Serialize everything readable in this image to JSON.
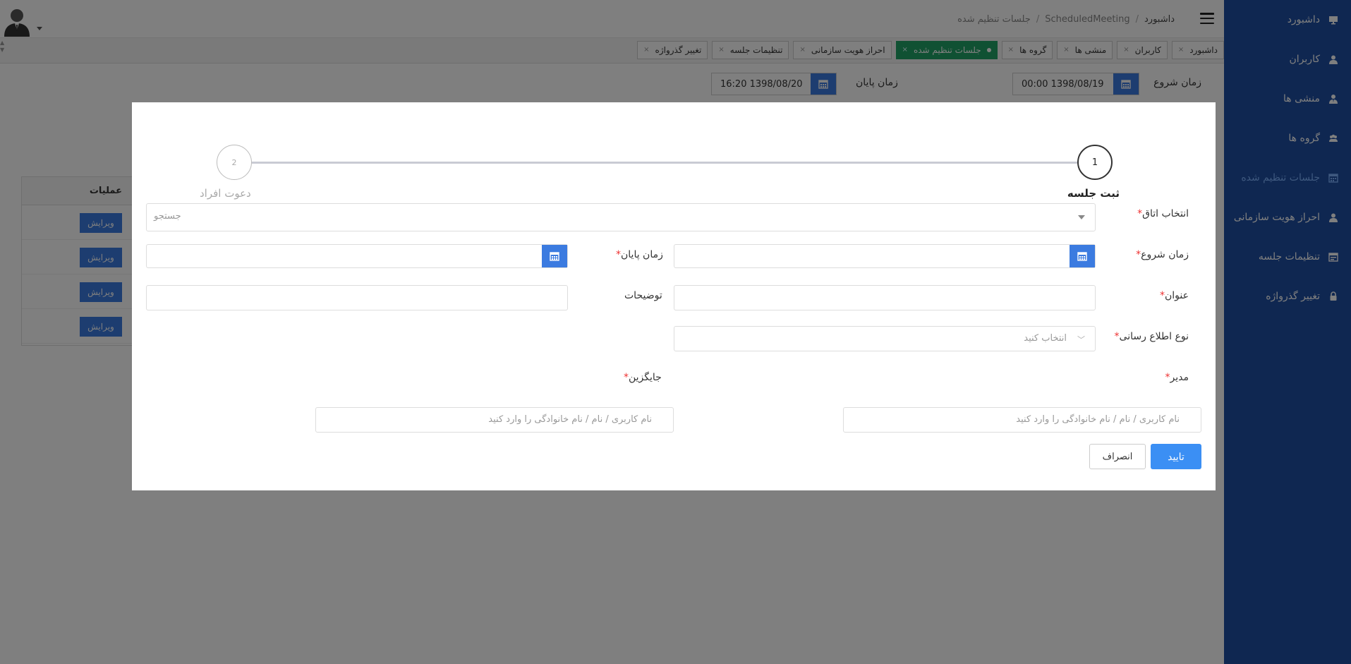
{
  "breadcrumb": {
    "home": "داشبورد",
    "section": "ScheduledMeeting",
    "current": "جلسات تنظیم شده"
  },
  "tabs": [
    {
      "label": "داشبورد",
      "close": "×"
    },
    {
      "label": "کاربران",
      "close": "×"
    },
    {
      "label": "منشی ها",
      "close": "×"
    },
    {
      "label": "گروه ها",
      "close": "×"
    },
    {
      "label": "جلسات تنظیم شده",
      "close": "×",
      "active": true
    },
    {
      "label": "احراز هویت سازمانی",
      "close": "×"
    },
    {
      "label": "تنظیمات جلسه",
      "close": "×"
    },
    {
      "label": "تغییر گذرواژه",
      "close": "×"
    }
  ],
  "filters": {
    "start_label": "زمان شروع",
    "start_value": "00:00 1398/08/19",
    "end_label": "زمان پایان",
    "end_value": "16:20 1398/08/20"
  },
  "table": {
    "header": "عملیات",
    "edit_label": "ویرایش"
  },
  "sidebar": {
    "items": [
      {
        "label": "داشبورد",
        "icon": "dashboard-icon"
      },
      {
        "label": "کاربران",
        "icon": "user-icon"
      },
      {
        "label": "منشی ها",
        "icon": "user-tie-icon"
      },
      {
        "label": "گروه ها",
        "icon": "users-icon"
      },
      {
        "label": "جلسات تنظیم شده",
        "icon": "calendar-icon",
        "active": true
      },
      {
        "label": "احراز هویت سازمانی",
        "icon": "user-check-icon"
      },
      {
        "label": "تنظیمات جلسه",
        "icon": "settings-calendar-icon"
      },
      {
        "label": "تغییر گذرواژه",
        "icon": "lock-icon"
      }
    ]
  },
  "modal": {
    "steps": [
      {
        "number": "1",
        "label": "ثبت جلسه"
      },
      {
        "number": "2",
        "label": "دعوت افراد"
      }
    ],
    "room_label": "انتخاب اتاق",
    "room_placeholder": "جستجو",
    "start_label": "زمان شروع",
    "end_label": "زمان پایان",
    "title_label": "عنوان",
    "description_label": "توضیحات",
    "notify_label": "نوع اطلاع رسانی",
    "notify_placeholder": "انتخاب کنید",
    "manager_label": "مدیر",
    "substitute_label": "جایگزین",
    "manager_placeholder": "نام کاربری / نام / نام خانوادگی را وارد کنید",
    "substitute_placeholder": "نام کاربری / نام / نام خانوادگی را وارد کنید",
    "required_mark": "*",
    "confirm_label": "تایید",
    "cancel_label": "انصراف"
  },
  "colors": {
    "sidebar": "#1e4fa3",
    "primary": "#3b7be0",
    "active_tab": "#21a366",
    "required": "#e33333"
  }
}
